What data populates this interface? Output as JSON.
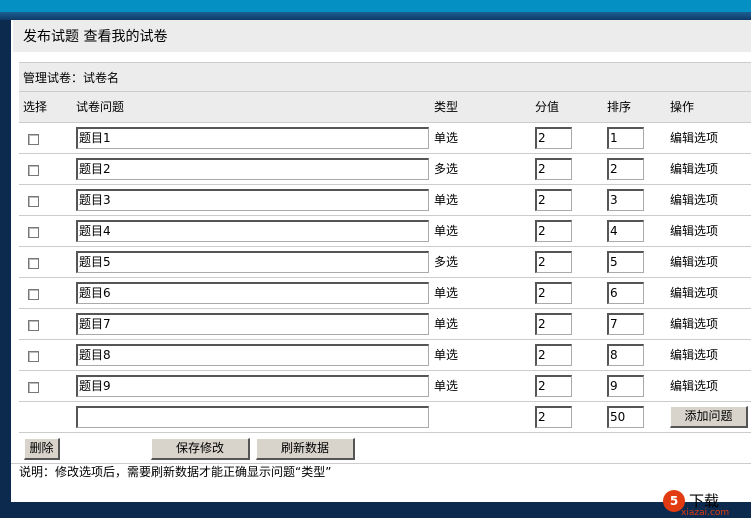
{
  "title": {
    "publish": "发布试题",
    "view": "查看我的试卷"
  },
  "section": "管理试卷：试卷名",
  "headers": {
    "select": "选择",
    "question": "试卷问题",
    "type": "类型",
    "score": "分值",
    "order": "排序",
    "action": "操作"
  },
  "rows": [
    {
      "q": "题目1",
      "type": "单选",
      "score": "2",
      "order": "1",
      "action": "编辑选项"
    },
    {
      "q": "题目2",
      "type": "多选",
      "score": "2",
      "order": "2",
      "action": "编辑选项"
    },
    {
      "q": "题目3",
      "type": "单选",
      "score": "2",
      "order": "3",
      "action": "编辑选项"
    },
    {
      "q": "题目4",
      "type": "单选",
      "score": "2",
      "order": "4",
      "action": "编辑选项"
    },
    {
      "q": "题目5",
      "type": "多选",
      "score": "2",
      "order": "5",
      "action": "编辑选项"
    },
    {
      "q": "题目6",
      "type": "单选",
      "score": "2",
      "order": "6",
      "action": "编辑选项"
    },
    {
      "q": "题目7",
      "type": "单选",
      "score": "2",
      "order": "7",
      "action": "编辑选项"
    },
    {
      "q": "题目8",
      "type": "单选",
      "score": "2",
      "order": "8",
      "action": "编辑选项"
    },
    {
      "q": "题目9",
      "type": "单选",
      "score": "2",
      "order": "9",
      "action": "编辑选项"
    }
  ],
  "new_row": {
    "q": "",
    "score": "2",
    "order": "50",
    "add": "添加问题"
  },
  "buttons": {
    "delete": "删除",
    "save": "保存修改",
    "refresh": "刷新数据"
  },
  "note": "说明：修改选项后，需要刷新数据才能正确显示问题“类型”",
  "watermark": {
    "text": "下载",
    "sub": "xiazai.com"
  }
}
